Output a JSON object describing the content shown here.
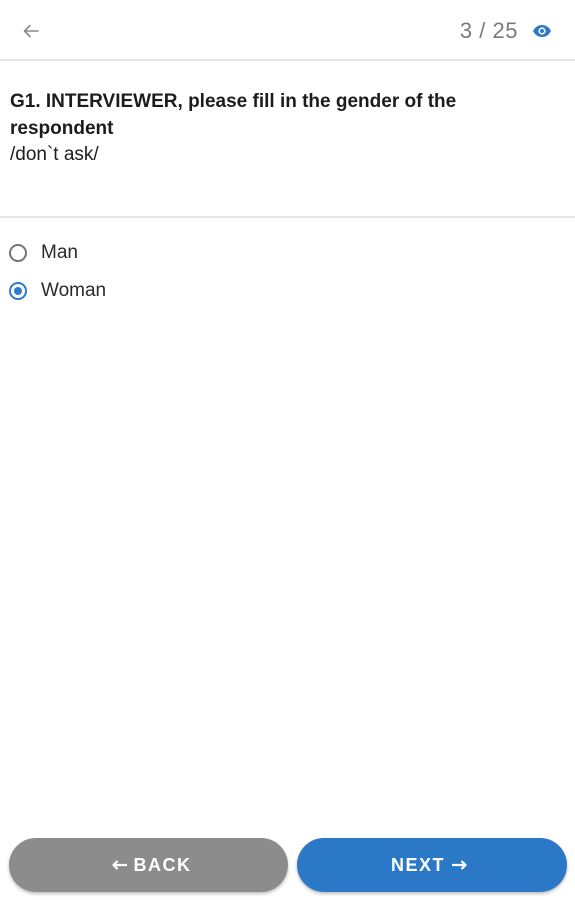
{
  "header": {
    "progress_current": "3",
    "progress_separator": "/",
    "progress_total": "25"
  },
  "question": {
    "title": "G1. INTERVIEWER, please fill in the gender of the respondent",
    "note": "/don`t ask/"
  },
  "options": [
    {
      "label": "Man",
      "selected": false
    },
    {
      "label": "Woman",
      "selected": true
    }
  ],
  "footer": {
    "back_label": "BACK",
    "next_label": "NEXT"
  },
  "colors": {
    "accent": "#2b78c6",
    "back_button": "#8c8c8c"
  },
  "icons": {
    "back": "arrow-left-icon",
    "preview": "eye-icon"
  }
}
